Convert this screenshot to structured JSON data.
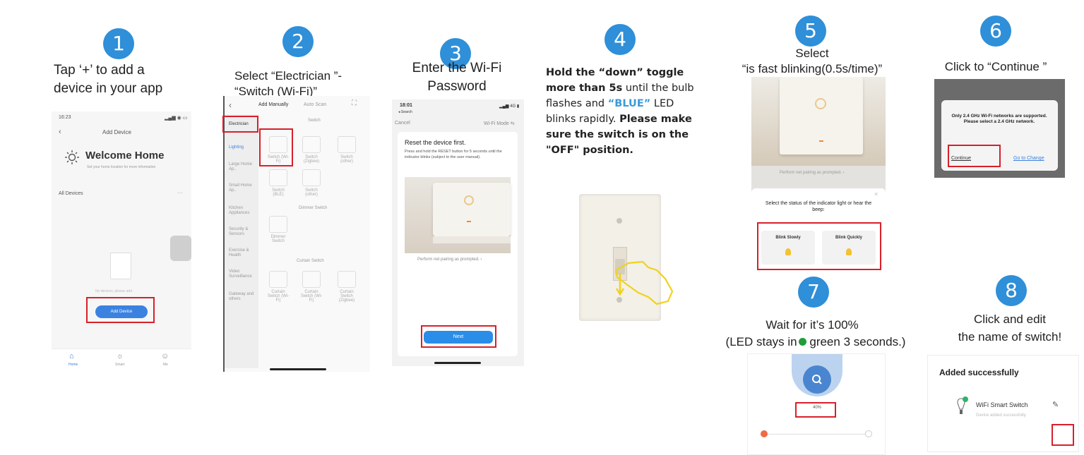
{
  "steps": [
    {
      "num": "1",
      "caption_line1": "Tap ‘+’ to add a",
      "caption_line2": "device in your app"
    },
    {
      "num": "2",
      "caption_line1": "Select “Electrician ”-",
      "caption_line2": "“Switch (Wi-Fi)”"
    },
    {
      "num": "3",
      "caption_line1": "Enter the Wi-Fi",
      "caption_line2": "Password"
    },
    {
      "num": "4",
      "bold1": "Hold the “down” toggle",
      "bold2": "more than 5s",
      "text2": " until the bulb",
      "text3": "flashes and ",
      "blue": "“BLUE”",
      "text3b": " LED",
      "text4": "blinks rapidly. ",
      "bold4": "Please make",
      "bold5": "sure the switch is on the",
      "bold6": "\"OFF\" position."
    },
    {
      "num": "5",
      "caption_line1": "Select",
      "caption_line2": "“is fast blinking(0.5s/time)”"
    },
    {
      "num": "6",
      "caption_line1": "Click to “Continue ”"
    },
    {
      "num": "7",
      "caption_line1": "Wait for it’s 100%",
      "caption_line2a": "(LED stays in",
      "caption_line2b": " green 3 seconds.)"
    },
    {
      "num": "8",
      "caption_line1": "Click and edit",
      "caption_line2": "the name of switch!"
    }
  ],
  "shot1": {
    "time": "16:23",
    "title": "Add Device",
    "welcome": "Welcome Home",
    "subtitle": "Set your home location for more information",
    "all_devices": "All Devices",
    "no_devices": "No devices, please add",
    "add_button": "Add Device",
    "tabs": [
      "Home",
      "Smart",
      "Me"
    ]
  },
  "shot2": {
    "tab_manual": "Add Manually",
    "tab_auto": "Auto Scan",
    "categories": [
      "Electrician",
      "Lighting",
      "Large Home Ap..",
      "Small Home Ap..",
      "Kitchen Appliances",
      "Security & Sensors",
      "Exercise & Health",
      "Video Surveillance",
      "Gateway and others"
    ],
    "section_switch": "Switch",
    "section_dimmer": "Dimmer Switch",
    "section_curtain": "Curtain Switch",
    "items": [
      "Switch (Wi-Fi)",
      "Switch (Zigbee)",
      "Switch (other)",
      "Switch (BLE)",
      "Switch (other)",
      "Dimmer Switch",
      "Curtain Switch (Wi-Fi)",
      "Curtain Switch (Wi-Fi)",
      "Curtain Switch (Zigbee)"
    ]
  },
  "shot3": {
    "time": "18:01",
    "back": "◂ Search",
    "cancel": "Cancel",
    "mode": "Wi-Fi Mode ⇆",
    "heading": "Reset the device first.",
    "body": "Press and hold the RESET button for 5 seconds until the indicator blinks (subject to the user manual).",
    "link": "Perform net pairing as prompted. ›",
    "next": "Next"
  },
  "shot5": {
    "link": "Perform net pairing as prompted. ›",
    "question": "Select the status of the indicator light or hear the beep:",
    "blink_slowly": "Blink Slowly",
    "blink_quickly": "Blink Quickly"
  },
  "shot6": {
    "message": "Only 2.4 GHz Wi-Fi networks are supported. Please select a 2.4 GHz network.",
    "continue": "Continue",
    "change": "Go to Change"
  },
  "shot7": {
    "percent": "40%"
  },
  "shot8": {
    "title": "Added successfully",
    "device": "WiFi Smart Switch",
    "status": "Device added successfully"
  },
  "colors": {
    "accent": "#2f8fd8",
    "highlight": "#d8202a",
    "blue_text": "#3a9ad9",
    "led_green": "#1f9d3a",
    "app_blue": "#3b82e0"
  }
}
